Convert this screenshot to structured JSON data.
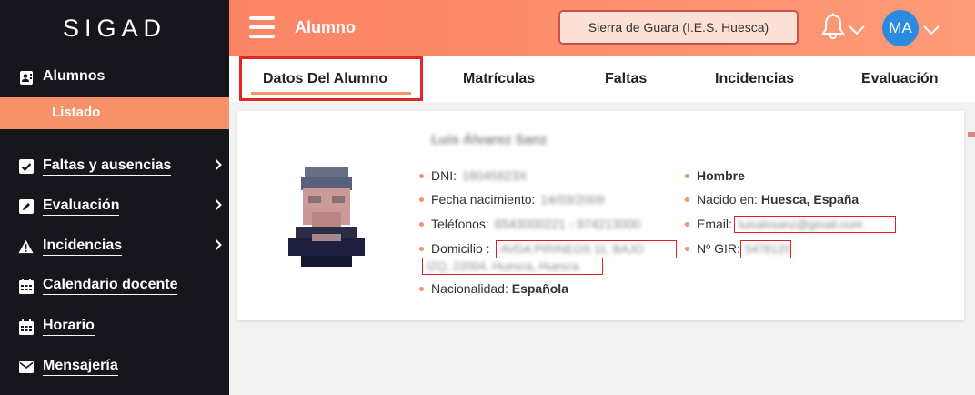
{
  "sidebar": {
    "logo": "SIGAD",
    "items": [
      {
        "label": "Alumnos",
        "icon": "contact-card-icon"
      },
      {
        "label": "Faltas y ausencias",
        "icon": "checkbox-icon"
      },
      {
        "label": "Evaluación",
        "icon": "pencil-icon"
      },
      {
        "label": "Incidencias",
        "icon": "warning-icon"
      },
      {
        "label": "Calendario docente",
        "icon": "calendar-icon"
      },
      {
        "label": "Horario",
        "icon": "calendar-icon"
      },
      {
        "label": "Mensajería",
        "icon": "envelope-icon"
      }
    ],
    "active_sub": "Listado"
  },
  "header": {
    "title": "Alumno",
    "school": "Sierra de Guara (I.E.S. Huesca)",
    "avatar_initials": "MA"
  },
  "tabs": [
    {
      "label": "Datos Del Alumno"
    },
    {
      "label": "Matrículas"
    },
    {
      "label": "Faltas"
    },
    {
      "label": "Incidencias"
    },
    {
      "label": "Evaluación"
    }
  ],
  "student": {
    "name": "Luis Álvarez Sanz",
    "left": {
      "dni_label": "DNI:",
      "dni_value": "18045823X",
      "birth_label": "Fecha nacimiento:",
      "birth_value": "14/03/2009",
      "phones_label": "Teléfonos:",
      "phones_value": "6543000221 - 974213000",
      "address_label": "Domicilio :",
      "address_line1": "AVDA PIRINEOS 11, BAJO",
      "address_line2": "IZQ, 22004, Huesca, Huesca",
      "nationality_label": "Nacionalidad:",
      "nationality_value": "Española"
    },
    "right": {
      "gender": "Hombre",
      "born_label": "Nacido en:",
      "born_value": "Huesca, España",
      "email_label": "Email:",
      "email_value": "luisalvsanz@gmail.com",
      "gir_label": "Nº GIR:",
      "gir_value": "5478120"
    }
  }
}
